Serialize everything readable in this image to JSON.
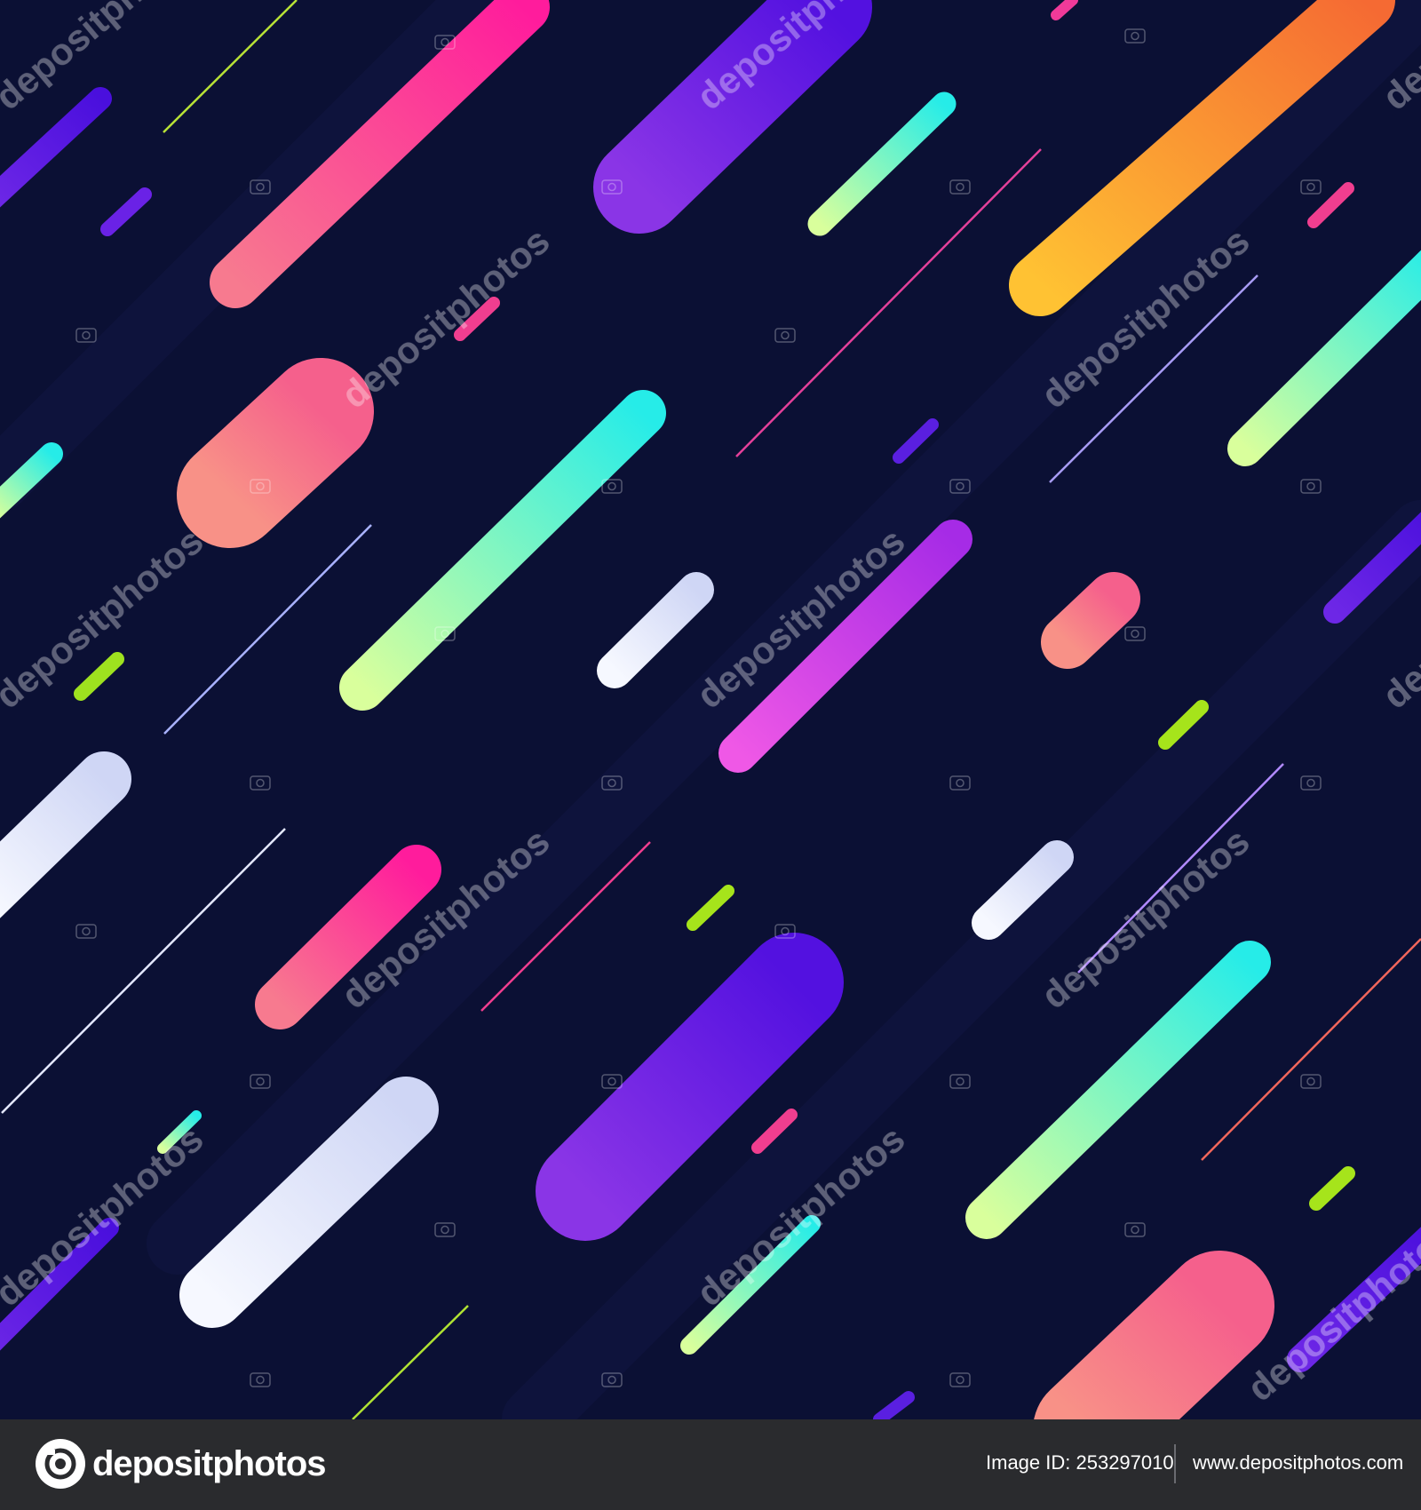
{
  "artwork": {
    "background": "#0b1034",
    "watermark_text": "depositphotos",
    "watermark_icon": "camera-icon"
  },
  "footer": {
    "brand_name": "depositphotos",
    "brand_icon": "depositphotos-logo-icon",
    "image_id": "Image ID: 253297010",
    "url": "www.depositphotos.com",
    "background": "#2a2b2e"
  }
}
